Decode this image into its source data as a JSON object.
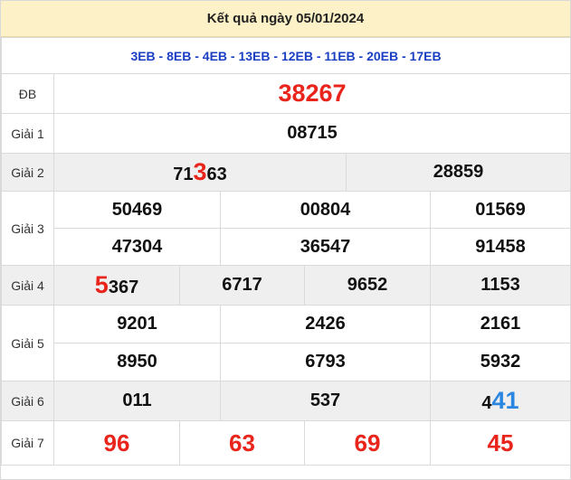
{
  "title": "Kết quả ngày 05/01/2024",
  "codes": "3EB - 8EB - 4EB - 13EB - 12EB - 11EB - 20EB - 17EB",
  "labels": {
    "db": "ĐB",
    "g1": "Giải 1",
    "g2": "Giải 2",
    "g3": "Giải 3",
    "g4": "Giải 4",
    "g5": "Giải 5",
    "g6": "Giải 6",
    "g7": "Giải 7"
  },
  "db": "38267",
  "g1": "08715",
  "g2": [
    {
      "pre": "71",
      "hl": "3",
      "post": "63"
    },
    {
      "pre": "28859",
      "hl": "",
      "post": ""
    }
  ],
  "g3": [
    "50469",
    "00804",
    "01569",
    "47304",
    "36547",
    "91458"
  ],
  "g4": [
    {
      "pre": "",
      "hl": "5",
      "post": "367"
    },
    {
      "pre": "6717",
      "hl": "",
      "post": ""
    },
    {
      "pre": "9652",
      "hl": "",
      "post": ""
    },
    {
      "pre": "1153",
      "hl": "",
      "post": ""
    }
  ],
  "g5": [
    "9201",
    "2426",
    "2161",
    "8950",
    "6793",
    "5932"
  ],
  "g6": [
    {
      "pre": "011",
      "hl": "",
      "post": ""
    },
    {
      "pre": "537",
      "hl": "",
      "post": ""
    },
    {
      "pre": "4",
      "hl": "41",
      "post": ""
    }
  ],
  "g7": [
    "96",
    "63",
    "69",
    "45"
  ],
  "colors": {
    "highlight_red": "#e8241b",
    "highlight_blue": "#2a86e0",
    "header_bg": "#fdf1c7",
    "codes": "#1a3fc2"
  }
}
